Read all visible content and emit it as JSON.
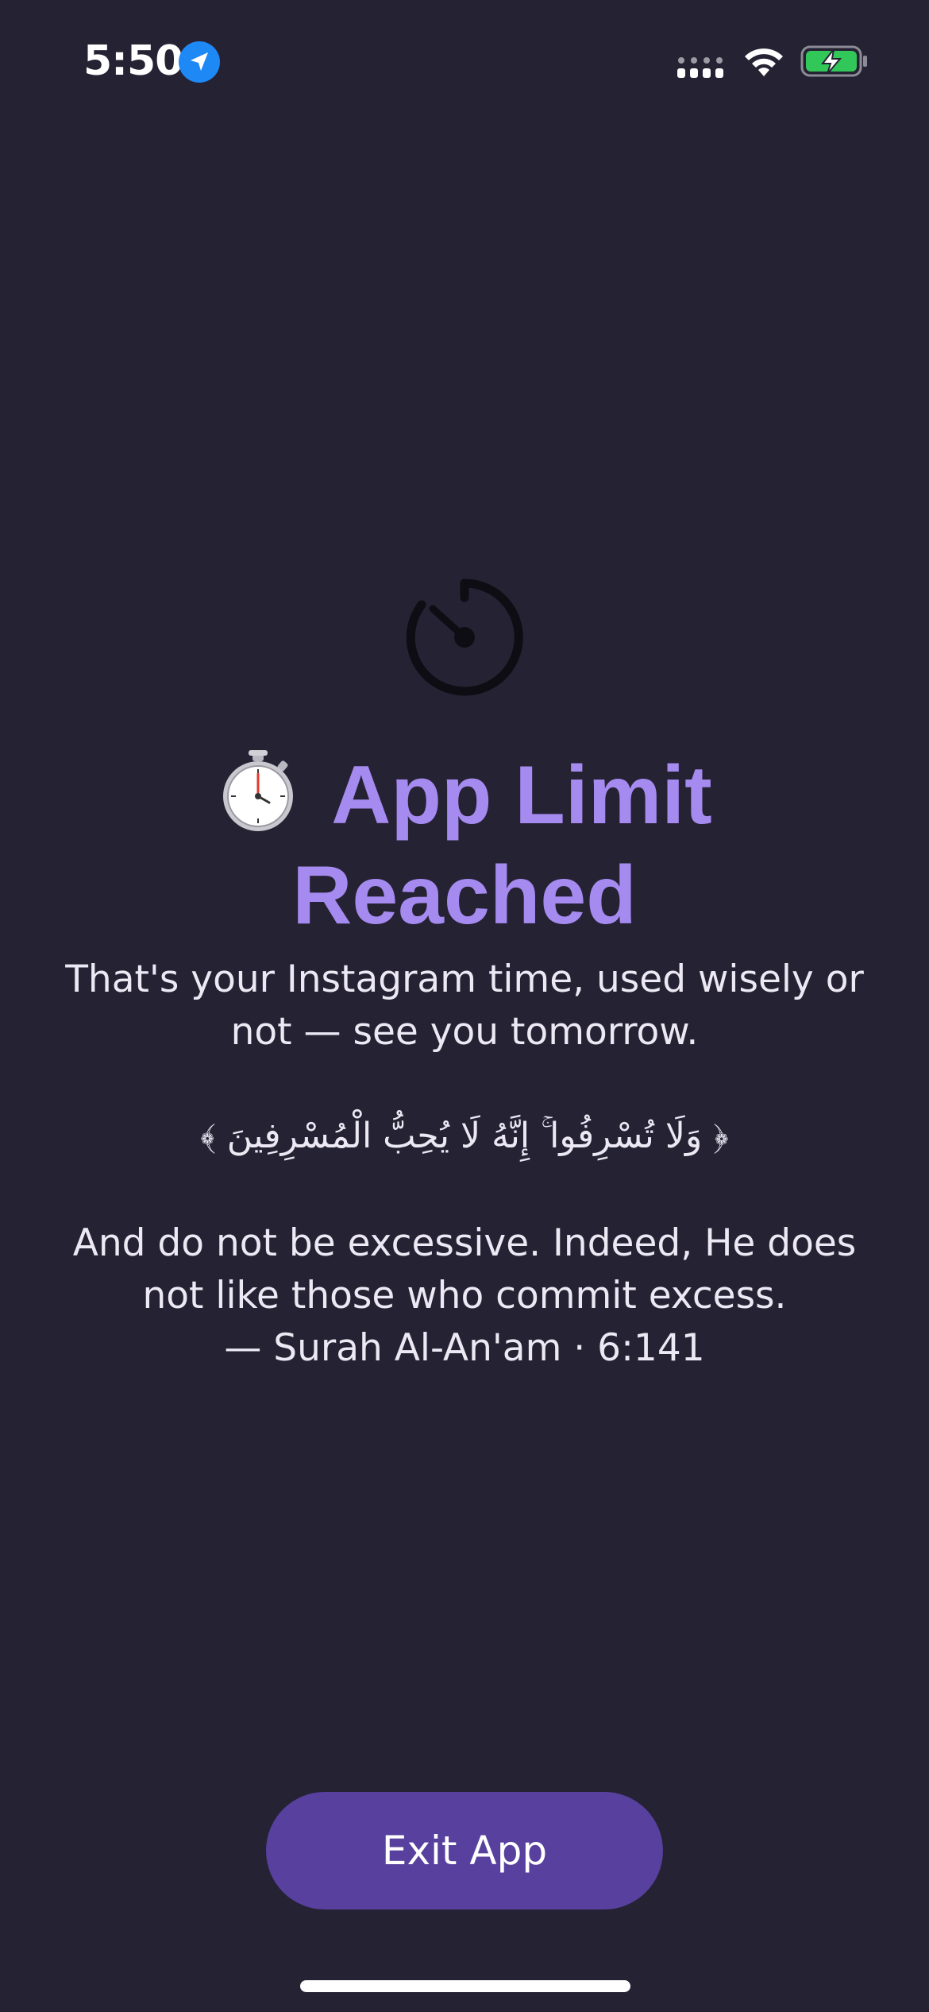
{
  "status_bar": {
    "time": "5:50",
    "location_icon": "location-arrow-icon",
    "cellular_icon": "cellular-signal-icon",
    "wifi_icon": "wifi-icon",
    "battery_icon": "battery-charging-icon",
    "battery_color": "#32C759"
  },
  "timer_icon": "timer-icon",
  "title": {
    "icon": "stopwatch-icon",
    "line1": "App Limit",
    "line2": "Reached",
    "color": "#A58AF0"
  },
  "message": "That's your Instagram time, used wisely or not — see you tomorrow.",
  "verse": {
    "arabic": "﴿ وَلَا تُسْرِفُوا ۚ إِنَّهُ لَا يُحِبُّ الْمُسْرِفِينَ ﴾",
    "translation": "And do not be excessive. Indeed, He does not like those who commit excess.",
    "reference": "— Surah Al-An'am · 6:141"
  },
  "exit_button": {
    "label": "Exit App",
    "color": "#57409E"
  },
  "colors": {
    "background": "#252233",
    "text": "#ECE9F4"
  }
}
